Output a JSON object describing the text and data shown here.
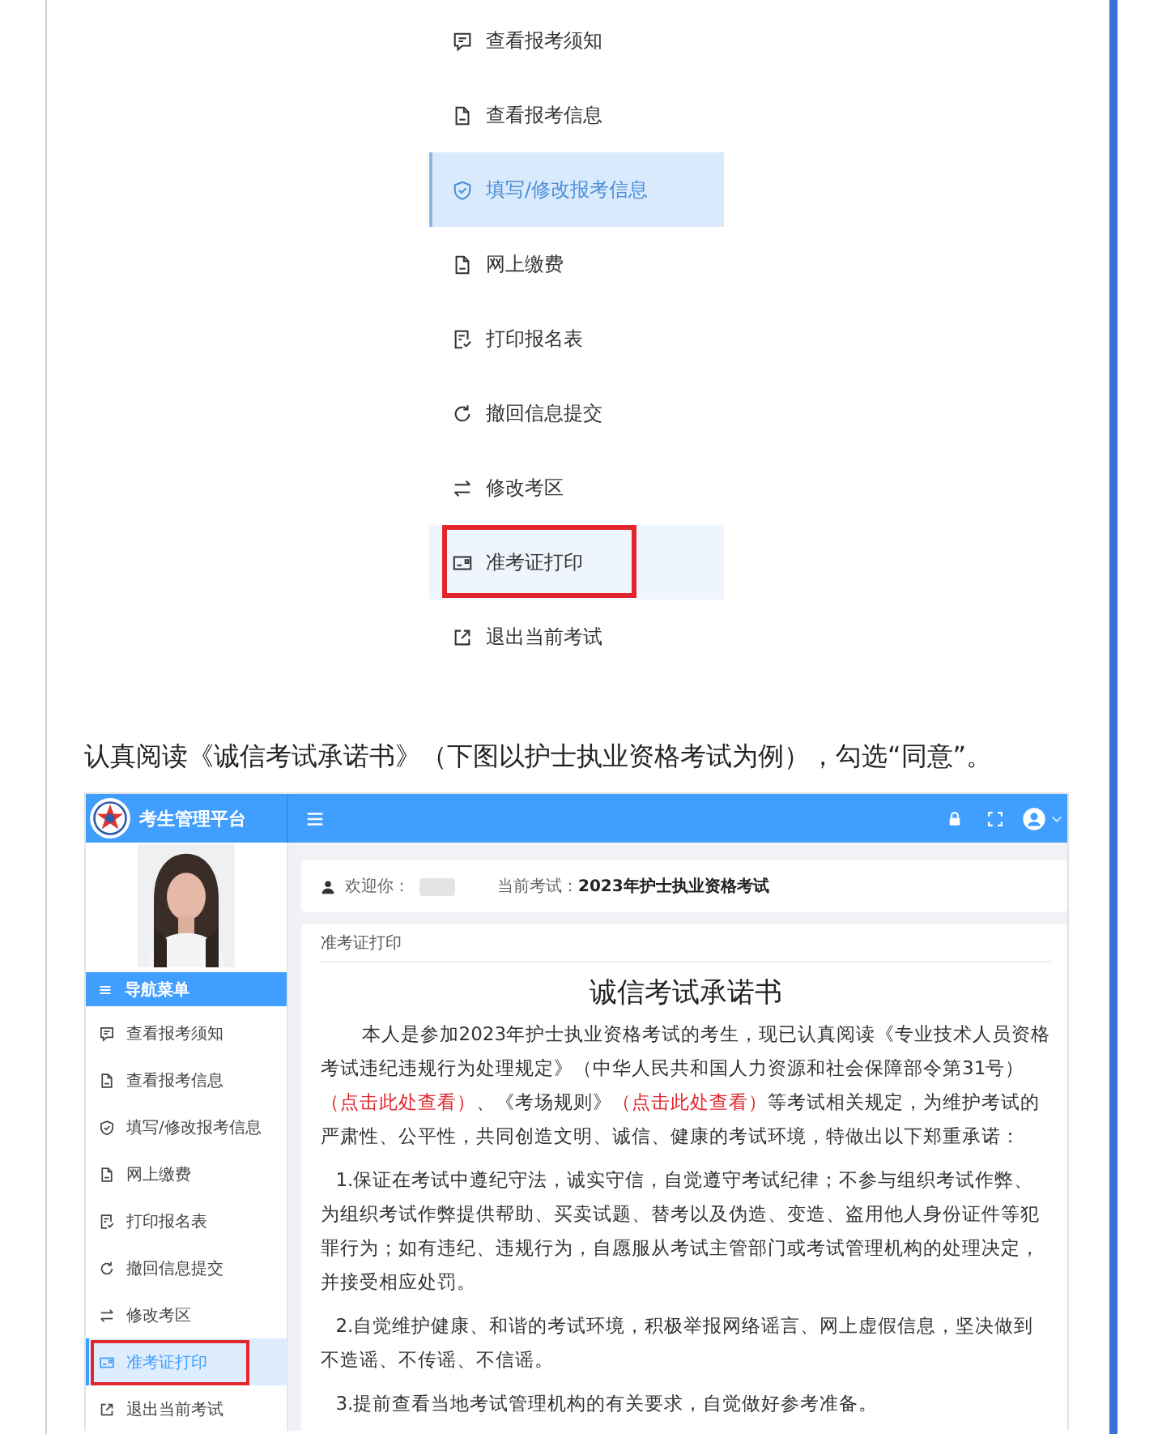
{
  "guide_menu": {
    "items": [
      {
        "label": "查看报考须知",
        "selected": false,
        "hovered": false,
        "annotated": false
      },
      {
        "label": "查看报考信息",
        "selected": false,
        "hovered": false,
        "annotated": false
      },
      {
        "label": "填写/修改报考信息",
        "selected": true,
        "hovered": false,
        "annotated": false
      },
      {
        "label": "网上缴费",
        "selected": false,
        "hovered": false,
        "annotated": false
      },
      {
        "label": "打印报名表",
        "selected": false,
        "hovered": false,
        "annotated": false
      },
      {
        "label": "撤回信息提交",
        "selected": false,
        "hovered": false,
        "annotated": false
      },
      {
        "label": "修改考区",
        "selected": false,
        "hovered": false,
        "annotated": false
      },
      {
        "label": "准考证打印",
        "selected": false,
        "hovered": true,
        "annotated": true
      },
      {
        "label": "退出当前考试",
        "selected": false,
        "hovered": false,
        "annotated": false
      }
    ]
  },
  "instruction": "认真阅读《诚信考试承诺书》（下图以护士执业资格考试为例），勾选“同意”。",
  "portal": {
    "title": "考生管理平台",
    "welcome_label": "欢迎你：",
    "exam_label": "当前考试：",
    "exam_name": "2023年护士执业资格考试",
    "nav_title": "导航菜单",
    "nav_items": [
      {
        "label": "查看报考须知",
        "selected": false,
        "annotated": false
      },
      {
        "label": "查看报考信息",
        "selected": false,
        "annotated": false
      },
      {
        "label": "填写/修改报考信息",
        "selected": false,
        "annotated": false
      },
      {
        "label": "网上缴费",
        "selected": false,
        "annotated": false
      },
      {
        "label": "打印报名表",
        "selected": false,
        "annotated": false
      },
      {
        "label": "撤回信息提交",
        "selected": false,
        "annotated": false
      },
      {
        "label": "修改考区",
        "selected": false,
        "annotated": false
      },
      {
        "label": "准考证打印",
        "selected": true,
        "annotated": true
      },
      {
        "label": "退出当前考试",
        "selected": false,
        "annotated": false
      }
    ],
    "breadcrumb": "准考证打印",
    "heading": "诚信考试承诺书",
    "paragraphs": [
      {
        "kind": "intro",
        "segments": [
          {
            "kind": "text",
            "text": "本人是参加2023年护士执业资格考试的考生，现已认真阅读《专业技术人员资格考试违纪违规行为处理规定》（中华人民共和国人力资源和社会保障部令第31号）"
          },
          {
            "kind": "link",
            "text": "（点击此处查看）"
          },
          {
            "kind": "text",
            "text": "、《考场规则》"
          },
          {
            "kind": "link",
            "text": "（点击此处查看）"
          },
          {
            "kind": "text",
            "text": "等考试相关规定，为维护考试的严肃性、公平性，共同创造文明、诚信、健康的考试环境，特做出以下郑重承诺："
          }
        ]
      },
      {
        "kind": "item",
        "segments": [
          {
            "kind": "text",
            "text": "1.保证在考试中遵纪守法，诚实守信，自觉遵守考试纪律；不参与组织考试作弊、为组织考试作弊提供帮助、买卖试题、替考以及伪造、变造、盗用他人身份证件等犯罪行为；如有违纪、违规行为，自愿服从考试主管部门或考试管理机构的处理决定，并接受相应处罚。"
          }
        ]
      },
      {
        "kind": "item",
        "segments": [
          {
            "kind": "text",
            "text": "2.自觉维护健康、和谐的考试环境，积极举报网络谣言、网上虚假信息，坚决做到不造谣、不传谣、不信谣。"
          }
        ]
      },
      {
        "kind": "item",
        "segments": [
          {
            "kind": "text",
            "text": "3.提前查看当地考试管理机构的有关要求，自觉做好参考准备。"
          }
        ]
      }
    ]
  }
}
